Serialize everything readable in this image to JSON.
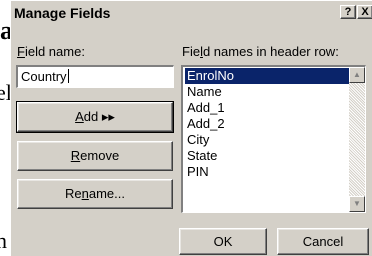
{
  "background_fragments": [
    "a",
    "el",
    "n"
  ],
  "dialog": {
    "title": "Manage Fields",
    "help_button": "?",
    "close_button": "X"
  },
  "field_name": {
    "label_underlined": "F",
    "label_rest": "ield name:",
    "value": "Country"
  },
  "header_row": {
    "label_pre": "Fie",
    "label_underlined": "l",
    "label_post": "d names in header row:",
    "items": [
      "EnrolNo",
      "Name",
      "Add_1",
      "Add_2",
      "City",
      "State",
      "PIN"
    ],
    "selected": "EnrolNo"
  },
  "buttons": {
    "add_underlined": "A",
    "add_rest": "dd ▸▸",
    "remove_underlined": "R",
    "remove_rest": "emove",
    "rename_pre": "Re",
    "rename_underlined": "n",
    "rename_post": "ame...",
    "ok": "OK",
    "cancel": "Cancel"
  },
  "icons": {
    "scroll_up": "triangle-up",
    "scroll_down": "triangle-down"
  },
  "colors": {
    "dialog_face": "#d4d0c8",
    "selection": "#0a246a"
  }
}
